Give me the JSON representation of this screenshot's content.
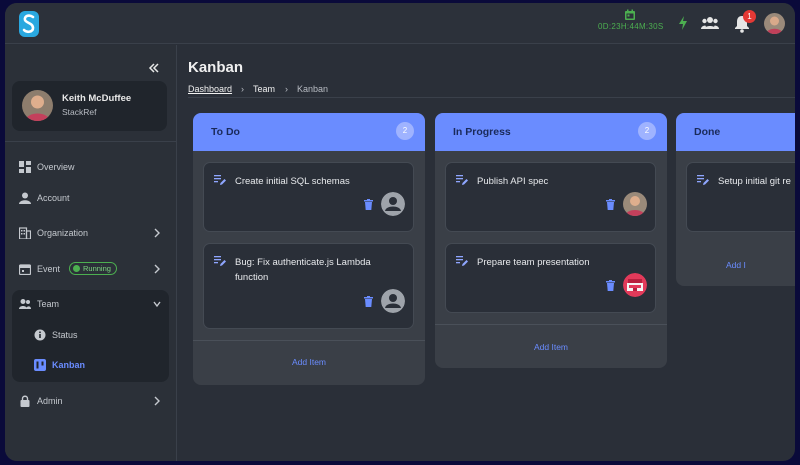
{
  "header": {
    "timer": "0D:23H:44M:30S",
    "notification_count": "1",
    "icons": [
      "calendar-icon",
      "bolt-icon",
      "people-icon",
      "bell-icon"
    ]
  },
  "sidebar": {
    "user": {
      "name": "Keith McDuffee",
      "org": "StackRef"
    },
    "items": [
      {
        "label": "Overview",
        "icon": "dashboard-icon"
      },
      {
        "label": "Account",
        "icon": "person-icon"
      },
      {
        "label": "Organization",
        "icon": "building-icon"
      },
      {
        "label": "Event",
        "icon": "calendar-icon",
        "status": "Running"
      },
      {
        "label": "Team",
        "icon": "people-icon"
      },
      {
        "label": "Status",
        "icon": "info-icon"
      },
      {
        "label": "Kanban",
        "icon": "kanban-icon"
      },
      {
        "label": "Admin",
        "icon": "lock-icon"
      }
    ]
  },
  "page": {
    "title": "Kanban",
    "breadcrumb": [
      "Dashboard",
      "Team",
      "Kanban"
    ]
  },
  "columns": [
    {
      "title": "To Do",
      "count": "2",
      "cards": [
        {
          "title": "Create initial SQL schemas",
          "assignee": "default-avatar"
        },
        {
          "title": "Bug: Fix authenticate.js Lambda function",
          "assignee": "default-avatar"
        }
      ],
      "add_label": "Add Item"
    },
    {
      "title": "In Progress",
      "count": "2",
      "cards": [
        {
          "title": "Publish API spec",
          "assignee": "photo-avatar"
        },
        {
          "title": "Prepare team presentation",
          "assignee": "pixel-avatar"
        }
      ],
      "add_label": "Add Item"
    },
    {
      "title": "Done",
      "cards": [
        {
          "title": "Setup initial git re"
        }
      ],
      "add_label": "Add I"
    }
  ],
  "colors": {
    "accent": "#6a8cff",
    "running": "#4caf50",
    "badge": "#e53935"
  }
}
